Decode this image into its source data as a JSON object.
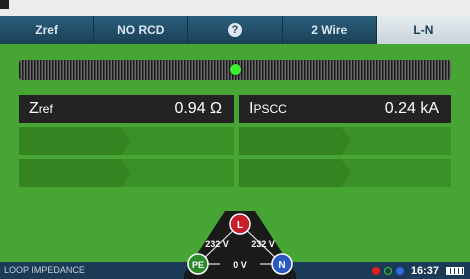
{
  "tabs": [
    {
      "label": "Zref",
      "active": false
    },
    {
      "label": "NO RCD",
      "active": false
    },
    {
      "label": "?",
      "active": false
    },
    {
      "label": "2 Wire",
      "active": false
    },
    {
      "label": "L-N",
      "active": true
    }
  ],
  "meter": {
    "level": 0.5
  },
  "readings": {
    "zref": {
      "label": "Z",
      "sub": "ref",
      "value": "0.94 Ω"
    },
    "ipscc": {
      "label": "I",
      "sub": "PSCC",
      "value": "0.24 kA"
    }
  },
  "connection": {
    "l": "L",
    "pe": "PE",
    "n": "N",
    "v_l_pe": "232 V",
    "v_l_n": "232 V",
    "v_pe_n": "0 V"
  },
  "bottom": {
    "mode": "LOOP IMPEDANCE",
    "time": "16:37",
    "status_colors": [
      "#e02020",
      "#31d22a",
      "#2f6be0"
    ]
  }
}
